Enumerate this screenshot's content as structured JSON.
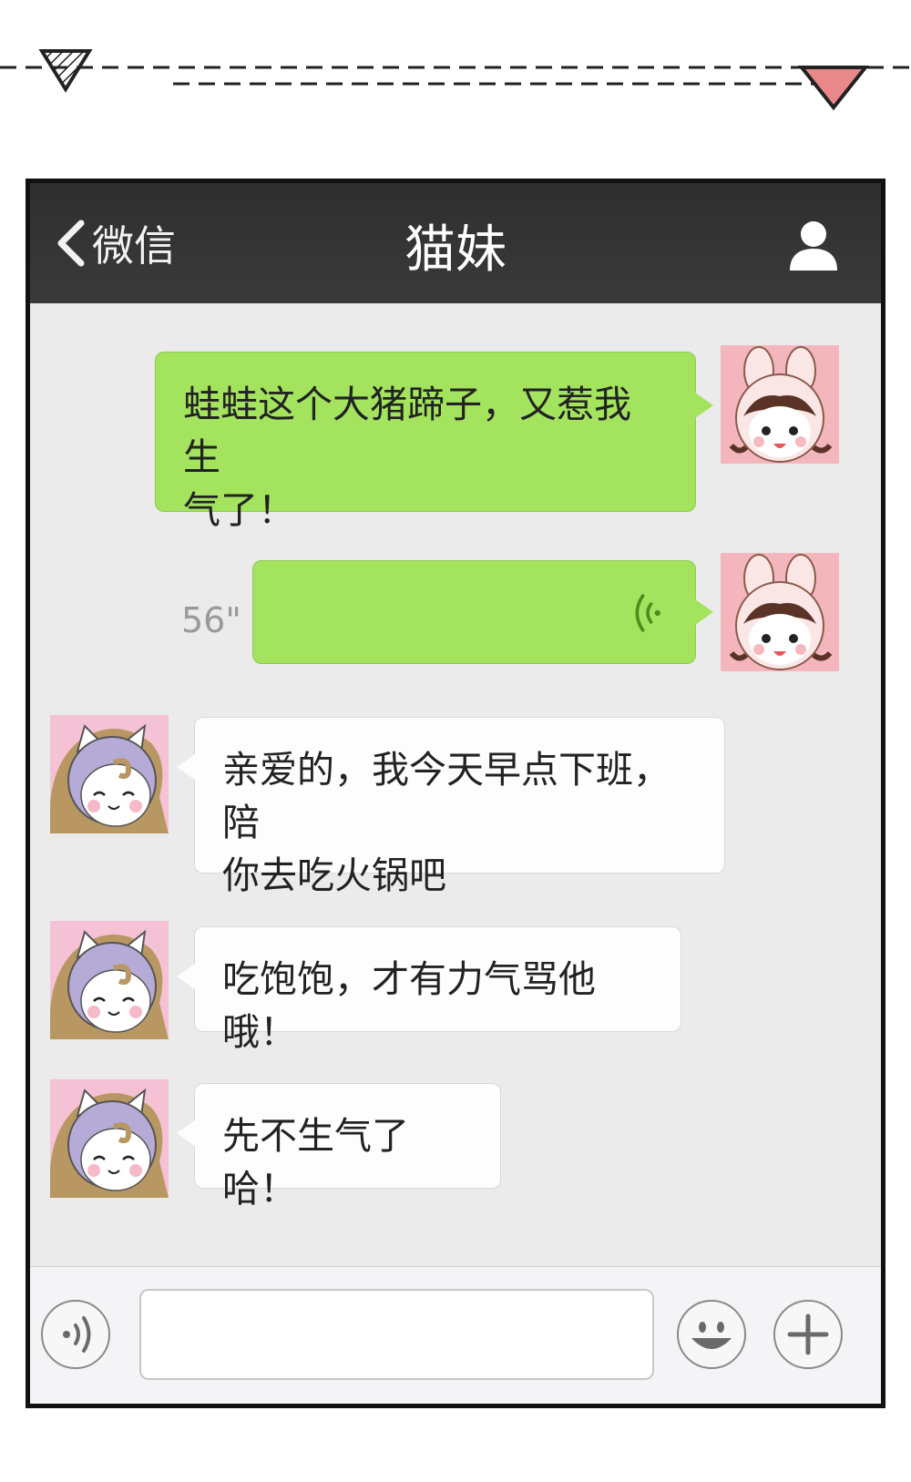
{
  "nav": {
    "back_label": "微信",
    "title": "猫妹"
  },
  "messages": [
    {
      "side": "right",
      "type": "text",
      "lines": [
        "蛙蛙这个大猪蹄子，又惹我生",
        "气了！"
      ]
    },
    {
      "side": "right",
      "type": "voice",
      "duration": "56\""
    },
    {
      "side": "left",
      "type": "text",
      "lines": [
        "亲爱的，我今天早点下班，陪",
        "你去吃火锅吧"
      ]
    },
    {
      "side": "left",
      "type": "text",
      "lines": [
        "吃饱饱，才有力气骂他哦！"
      ]
    },
    {
      "side": "left",
      "type": "text",
      "lines": [
        "先不生气了哈！"
      ]
    }
  ],
  "input": {
    "value": "",
    "placeholder": ""
  },
  "colors": {
    "nav_bg": "#333333",
    "chat_bg": "#ebebeb",
    "sent_bubble": "#a3e35e",
    "received_bubble": "#fdfdfd",
    "deco_dark": "#222222",
    "deco_pink": "#e8888a"
  },
  "icons": {
    "back": "chevron-left-icon",
    "profile": "person-icon",
    "voice_toggle": "voice-icon",
    "emoji": "smiley-icon",
    "more": "plus-icon",
    "sound_wave": "sound-wave-icon"
  }
}
